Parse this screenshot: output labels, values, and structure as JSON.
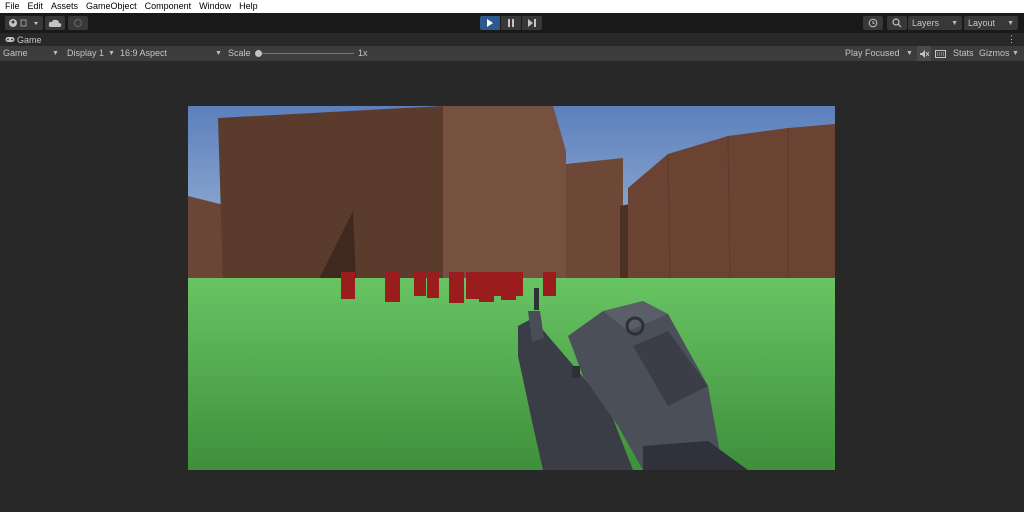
{
  "menu": [
    "File",
    "Edit",
    "Assets",
    "GameObject",
    "Component",
    "Window",
    "Help"
  ],
  "toolbar": {
    "layers_label": "Layers",
    "layout_label": "Layout"
  },
  "tab": {
    "label": "Game"
  },
  "game_toolbar": {
    "mode": "Game",
    "display": "Display 1",
    "aspect": "16:9 Aspect",
    "scale_label": "Scale",
    "scale_value": "1x",
    "play_focused": "Play Focused",
    "stats": "Stats",
    "gizmos": "Gizmos"
  },
  "icons": [
    "account-icon",
    "cloud-icon",
    "collab-icon",
    "play-icon",
    "pause-icon",
    "step-icon",
    "history-icon",
    "search-icon",
    "more-icon",
    "mute-icon",
    "keyboard-icon"
  ],
  "colors": {
    "play_active": "#2d5a8e",
    "sky": "#6a8bc0",
    "ground": "#4fa84c",
    "wall": "#6e4836",
    "barrel": "#9b1c1c"
  }
}
